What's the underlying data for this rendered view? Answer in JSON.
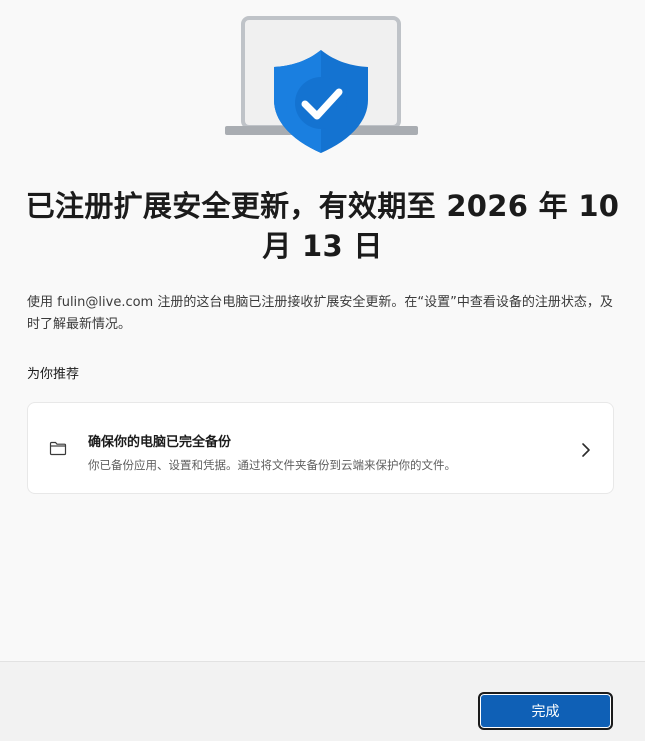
{
  "hero": {
    "icon": "laptop-shield-check-icon",
    "shield_color": "#1473d1"
  },
  "title": "已注册扩展安全更新，有效期至 2026 年 10 月 13 日",
  "description": "使用 fulin@live.com 注册的这台电脑已注册接收扩展安全更新。在“设置”中查看设备的注册状态，及时了解最新情况。",
  "recommend": {
    "section_label": "为你推荐",
    "card": {
      "icon": "folder-icon",
      "title": "确保你的电脑已完全备份",
      "subtitle": "你已备份应用、设置和凭据。通过将文件夹备份到云端来保护你的文件。"
    }
  },
  "footer": {
    "done_label": "完成",
    "accent": "#0f60b6"
  }
}
